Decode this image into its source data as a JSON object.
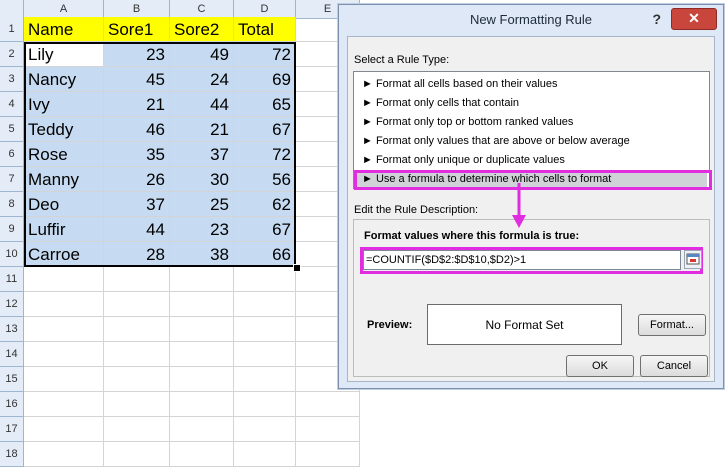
{
  "sheet": {
    "columns": [
      "A",
      "B",
      "C",
      "D",
      "E"
    ],
    "rows": [
      "1",
      "2",
      "3",
      "4",
      "5",
      "6",
      "7",
      "8",
      "9",
      "10",
      "11",
      "12",
      "13",
      "14",
      "15",
      "16",
      "17",
      "18"
    ],
    "header_row": [
      "Name",
      "Sore1",
      "Sore2",
      "Total"
    ],
    "data": [
      {
        "name": "Lily",
        "s1": "23",
        "s2": "49",
        "total": "72"
      },
      {
        "name": "Nancy",
        "s1": "45",
        "s2": "24",
        "total": "69"
      },
      {
        "name": "Ivy",
        "s1": "21",
        "s2": "44",
        "total": "65"
      },
      {
        "name": "Teddy",
        "s1": "46",
        "s2": "21",
        "total": "67"
      },
      {
        "name": "Rose",
        "s1": "35",
        "s2": "37",
        "total": "72"
      },
      {
        "name": "Manny",
        "s1": "26",
        "s2": "30",
        "total": "56"
      },
      {
        "name": "Deo",
        "s1": "37",
        "s2": "25",
        "total": "62"
      },
      {
        "name": "Luffir",
        "s1": "44",
        "s2": "23",
        "total": "67"
      },
      {
        "name": "Carroe",
        "s1": "28",
        "s2": "38",
        "total": "66"
      }
    ],
    "colors": {
      "header_fill": "#ffff00",
      "selection_fill": "#c6dbf1"
    }
  },
  "dialog": {
    "title": "New Formatting Rule",
    "help": "?",
    "close": "✕",
    "select_rule_label": "Select a Rule Type:",
    "rule_types": [
      "► Format all cells based on their values",
      "► Format only cells that contain",
      "► Format only top or bottom ranked values",
      "► Format only values that are above or below average",
      "► Format only unique or duplicate values",
      "► Use a formula to determine which cells to format"
    ],
    "selected_rule_index": 5,
    "edit_desc_label": "Edit the Rule Description:",
    "formula_label": "Format values where this formula is true:",
    "formula": "=COUNTIF($D$2:$D$10,$D2)>1",
    "preview_label": "Preview:",
    "preview_text": "No Format Set",
    "format_button": "Format...",
    "ok_button": "OK",
    "cancel_button": "Cancel",
    "highlight_color": "#e02de0"
  }
}
